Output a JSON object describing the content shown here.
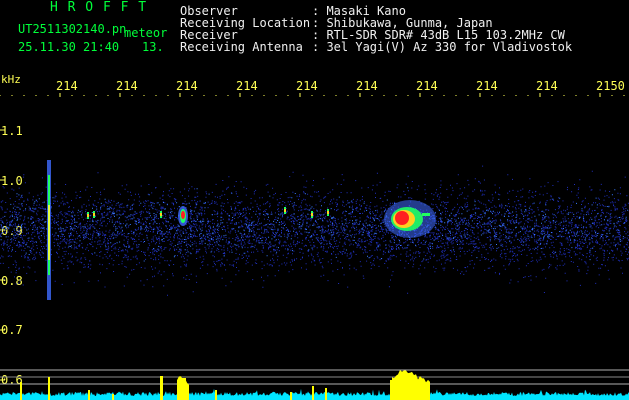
{
  "header": {
    "app_name": "H R O F F T",
    "filename": "UT2511302140.pn",
    "meteor_label": "meteor",
    "datetime": "25.11.30 21:40",
    "meteor_count": "13.",
    "info_labels": [
      "Observer",
      "Receiving Location",
      "Receiver",
      "Receiving Antenna"
    ],
    "info_values": [
      ": Masaki Kano",
      ": Shibukawa, Gunma, Japan",
      ": RTL-SDR SDR# 43dB L15 103.2MHz CW",
      ": 3el Yagi(V) Az 330 for Vladivostok"
    ]
  },
  "axis": {
    "y_unit": "kHz",
    "y_ticks": [
      "1.1",
      "1.0",
      "0.9",
      "0.8",
      "0.7",
      "0.6"
    ],
    "time_ticks": [
      "214",
      "214",
      "214",
      "214",
      "214",
      "214",
      "214",
      "214",
      "214",
      "2150"
    ]
  },
  "colors": {
    "background": "#000000",
    "header_green": "#00ff3a",
    "header_white": "#f0f0f0",
    "axis_yellow": "#ffff55",
    "noise_blue": "#2030c0",
    "signal_red": "#ff2020",
    "signal_green": "#20ff60",
    "level_cyan": "#00e5ff",
    "level_yellow": "#ffff00"
  }
}
